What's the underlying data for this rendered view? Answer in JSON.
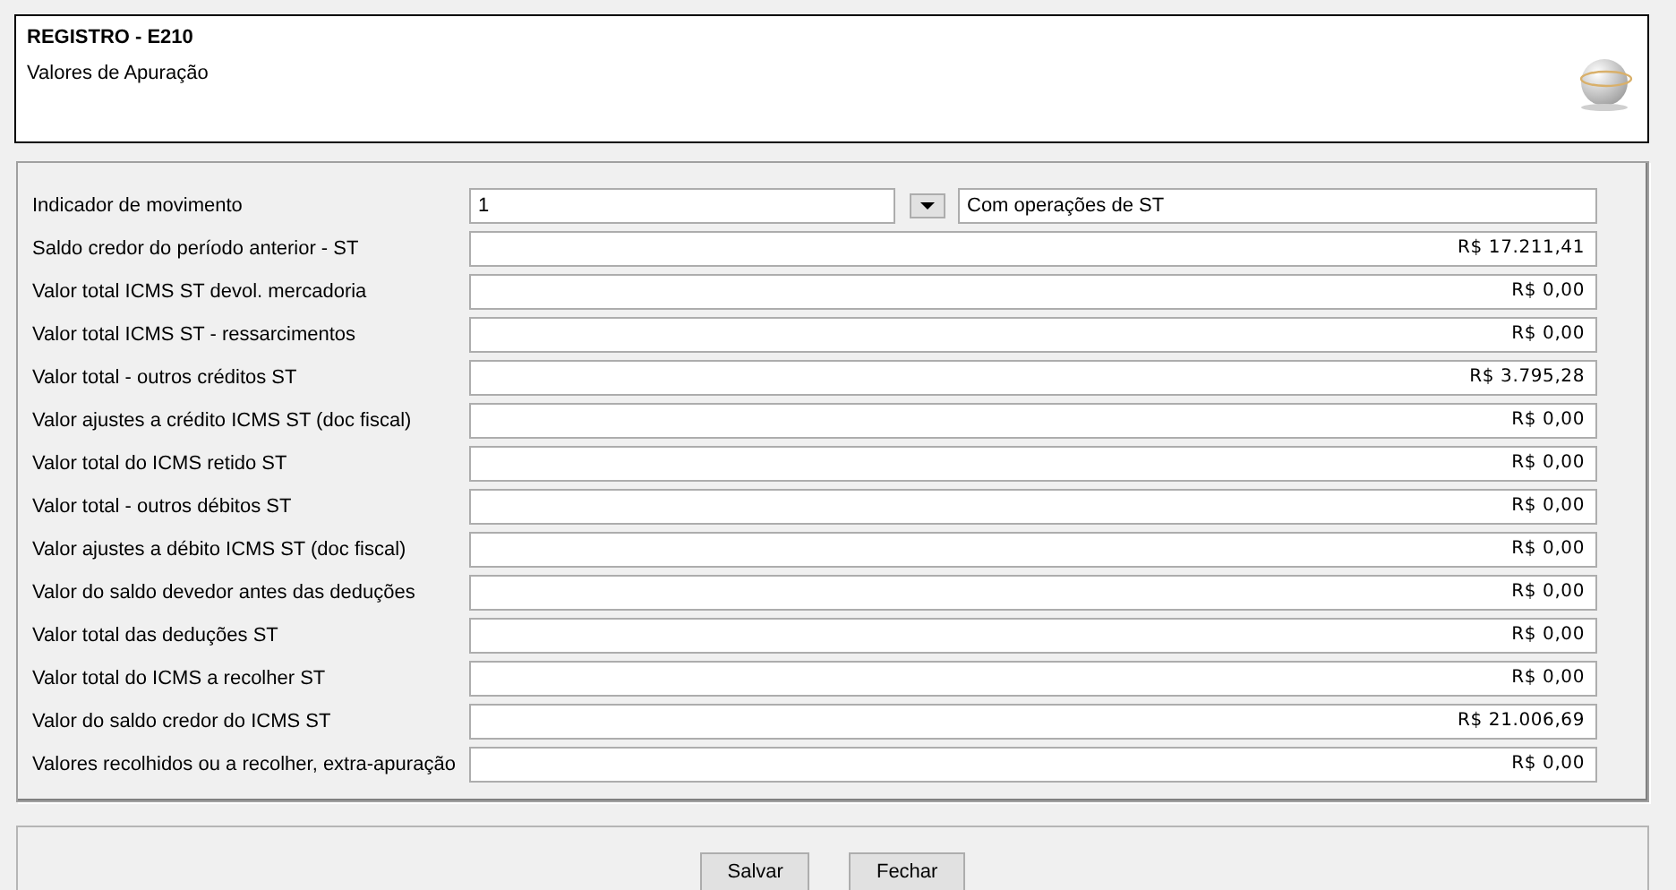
{
  "header": {
    "title": "REGISTRO - E210",
    "subtitle": "Valores de Apuração"
  },
  "indicator": {
    "label": "Indicador de movimento",
    "code": "1",
    "description": "Com operações de ST"
  },
  "fields": [
    {
      "label": "Saldo credor do período anterior - ST",
      "value": "R$ 17.211,41"
    },
    {
      "label": "Valor total ICMS ST devol. mercadoria",
      "value": "R$ 0,00"
    },
    {
      "label": "Valor total ICMS ST - ressarcimentos",
      "value": "R$ 0,00"
    },
    {
      "label": "Valor total - outros créditos ST",
      "value": "R$ 3.795,28"
    },
    {
      "label": "Valor ajustes a crédito ICMS ST (doc fiscal)",
      "value": "R$ 0,00"
    },
    {
      "label": "Valor total do ICMS retido ST",
      "value": "R$ 0,00"
    },
    {
      "label": "Valor total - outros débitos ST",
      "value": "R$ 0,00"
    },
    {
      "label": "Valor ajustes a débito ICMS ST (doc fiscal)",
      "value": "R$ 0,00"
    },
    {
      "label": "Valor do saldo devedor antes das deduções",
      "value": "R$ 0,00"
    },
    {
      "label": "Valor total das deduções ST",
      "value": "R$ 0,00"
    },
    {
      "label": "Valor total do ICMS a recolher ST",
      "value": "R$ 0,00"
    },
    {
      "label": "Valor do saldo credor do ICMS ST",
      "value": "R$ 21.006,69"
    },
    {
      "label": "Valores recolhidos ou a recolher, extra-apuração",
      "value": "R$ 0,00"
    }
  ],
  "buttons": [
    "Salvar",
    "Fechar"
  ]
}
